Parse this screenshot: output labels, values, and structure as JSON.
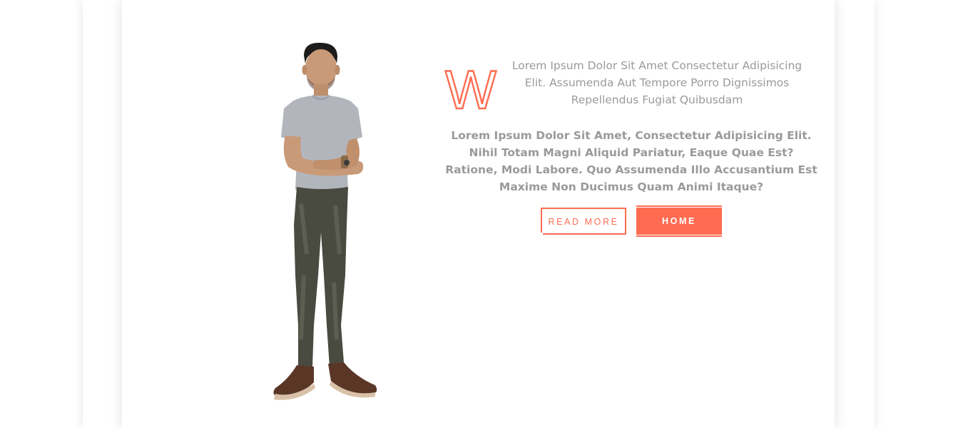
{
  "content": {
    "drop_cap_letter": "W",
    "intro": "Lorem Ipsum Dolor Sit Amet Consectetur Adipisicing Elit. Assumenda Aut Tempore Porro Dignissimos Repellendus Fugiat Quibusdam",
    "body": "Lorem Ipsum Dolor Sit Amet, Consectetur Adipisicing Elit. Nihil Totam Magni Aliquid Pariatur, Eaque Quae Est? Ratione, Modi Labore. Quo Assumenda Illo Accusantium Est Maxime Non Ducimus Quam Animi Itaque?"
  },
  "buttons": {
    "read_more": "READ MORE",
    "home": "HOME"
  },
  "colors": {
    "accent": "#ff6c52",
    "text": "#9a9a9a",
    "shirt": "#b3b5bc",
    "jeans": "#4a4b40",
    "shoes": "#5a3626",
    "skin": "#c99a78"
  }
}
